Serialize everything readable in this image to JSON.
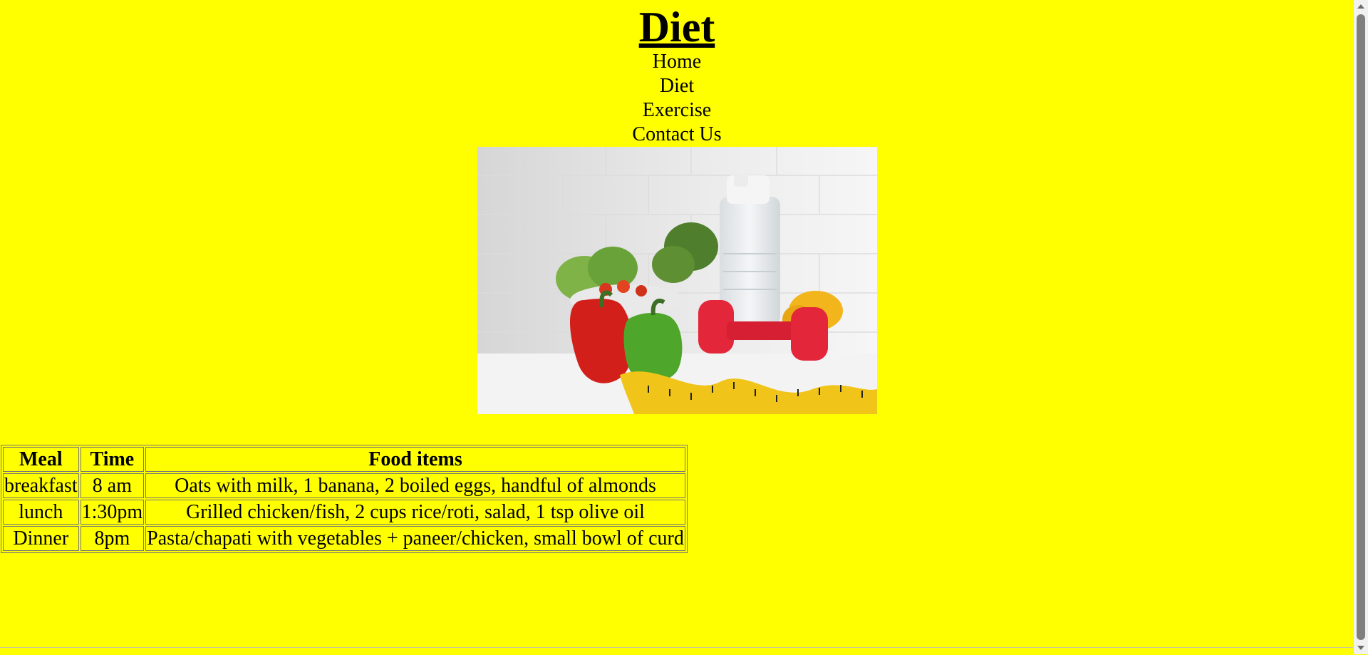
{
  "page": {
    "title": "Diet",
    "background": "#ffff00"
  },
  "nav": {
    "items": [
      {
        "label": "Home"
      },
      {
        "label": "Diet"
      },
      {
        "label": "Exercise"
      },
      {
        "label": "Contact Us"
      }
    ]
  },
  "hero_image": {
    "subject": "bell peppers, salad bowl, broccoli, water bottle, red dumbbell, yellow measuring tape"
  },
  "diet_table": {
    "headers": [
      "Meal",
      "Time",
      "Food items"
    ],
    "rows": [
      [
        "breakfast",
        "8 am",
        "Oats with milk, 1 banana, 2 boiled eggs, handful of almonds"
      ],
      [
        "lunch",
        "1:30pm",
        "Grilled chicken/fish, 2 cups rice/roti, salad, 1 tsp olive oil"
      ],
      [
        "Dinner",
        "8pm",
        "Pasta/chapati with vegetables + paneer/chicken, small bowl of curd"
      ]
    ]
  }
}
